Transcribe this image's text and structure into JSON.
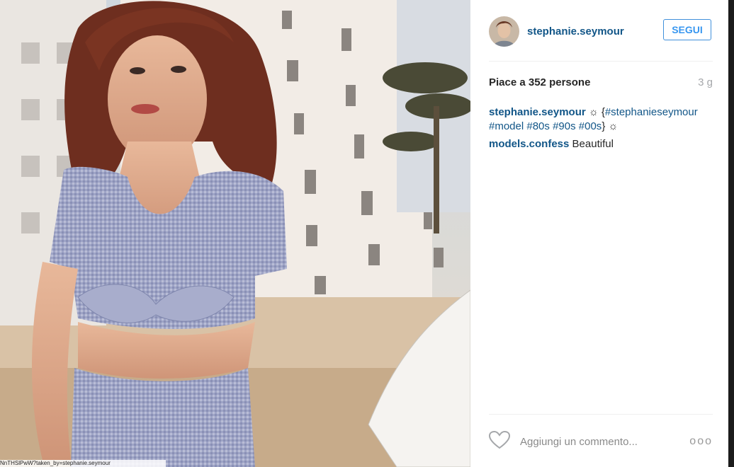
{
  "post": {
    "username": "stephanie.seymour",
    "follow_label": "SEGUI",
    "likes_text": "Piace a 352 persone",
    "time_ago": "3 g",
    "comments": [
      {
        "user": "stephanie.seymour",
        "sun1": "☼",
        "brace_open": "{",
        "tags": [
          "#stephanieseymour",
          "#model",
          "#80s",
          "#90s",
          "#00s"
        ],
        "brace_close": "}",
        "sun2": "☼"
      },
      {
        "user": "models.confess",
        "text": "Beautiful"
      }
    ],
    "comment_placeholder": "Aggiungi un commento...",
    "more_label": "ooo",
    "photo_caption": "NnTHSlPwW?taken_by=stephanie.seymour"
  },
  "icons": {
    "like": "heart-icon",
    "more": "more-options-icon"
  },
  "colors": {
    "username": "#125688",
    "follow": "#3897f0",
    "muted": "#a5a7aa"
  }
}
